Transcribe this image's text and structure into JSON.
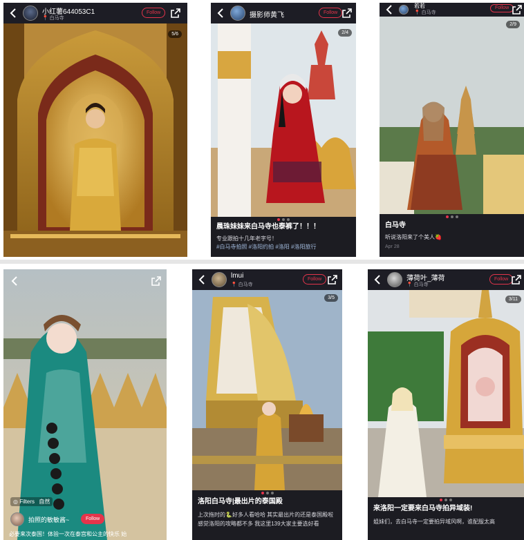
{
  "panels": [
    {
      "username": "小红薯644053C1",
      "location": "白马寺",
      "follow_label": "Follow",
      "counter": "5/6"
    },
    {
      "username": "摄影师黄飞",
      "location": "白马寺",
      "follow_label": "Follow",
      "counter": "2/4",
      "title": "晨珠妹妹来白马寺也泰裤了！！！",
      "body": "专业跟拍十几年老字号！",
      "tags": "#白马寺拍照  #洛阳约拍  #洛阳  #洛阳旅行"
    },
    {
      "username": "若若",
      "location": "白马寺",
      "follow_label": "Follow",
      "counter": "2/9",
      "title": "白马寺",
      "body": "听说洛阳来了个美人🍓",
      "date": "Apr 28"
    },
    {
      "filters_label": "Filters",
      "filter_name": "自然",
      "username": "拍照的敏敏酱~",
      "follow_label": "Follow",
      "body": "必要来次泰国！体验一次在泰宫和公主的快乐 始"
    },
    {
      "username": "lmui",
      "location": "白马寺",
      "follow_label": "Follow",
      "counter": "3/5",
      "title": "洛阳白马寺|最出片的泰国殿",
      "body": "上次拖时的🐍好多人看哈哈 其实最出片的还是泰国殿啦",
      "body2": "感觉洛阳的攻略都不多 我这里139大家主要选好看"
    },
    {
      "username": "薄荷叶_薄荷",
      "location": "白马寺",
      "follow_label": "Follow",
      "counter": "3/11",
      "title": "来洛阳一定要来白马寺拍异域装!",
      "body": "姐妹们，去白马寺一定要拍异域风啊，谁配服太高"
    }
  ]
}
